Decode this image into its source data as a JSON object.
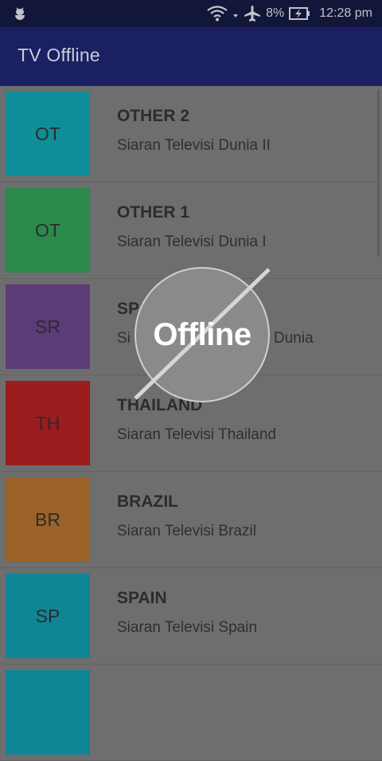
{
  "status_bar": {
    "battery": "8%",
    "time": "12:28 pm"
  },
  "app_bar": {
    "title": "TV Offline"
  },
  "channels": [
    {
      "code": "OT",
      "name": "OTHER 2",
      "desc": "Siaran Televisi Dunia II",
      "color": "#0f8e99"
    },
    {
      "code": "OT",
      "name": "OTHER 1",
      "desc": "Siaran Televisi Dunia I",
      "color": "#2b8a4b"
    },
    {
      "code": "SR",
      "name": "SP",
      "desc": "Si",
      "desc_tail": "Dunia",
      "color": "#5b3b78"
    },
    {
      "code": "TH",
      "name": "THAILAND",
      "desc": "Siaran Televisi Thailand",
      "color": "#9a1c1f"
    },
    {
      "code": "BR",
      "name": "BRAZIL",
      "desc": "Siaran Televisi Brazil",
      "color": "#9b6228"
    },
    {
      "code": "SP",
      "name": "SPAIN",
      "desc": "Siaran Televisi Spain",
      "color": "#0f8595"
    },
    {
      "code": "",
      "name": "",
      "desc": "",
      "color": "#0f8595"
    }
  ],
  "overlay": {
    "label": "Offline",
    "icon": "offline-slash-icon"
  }
}
